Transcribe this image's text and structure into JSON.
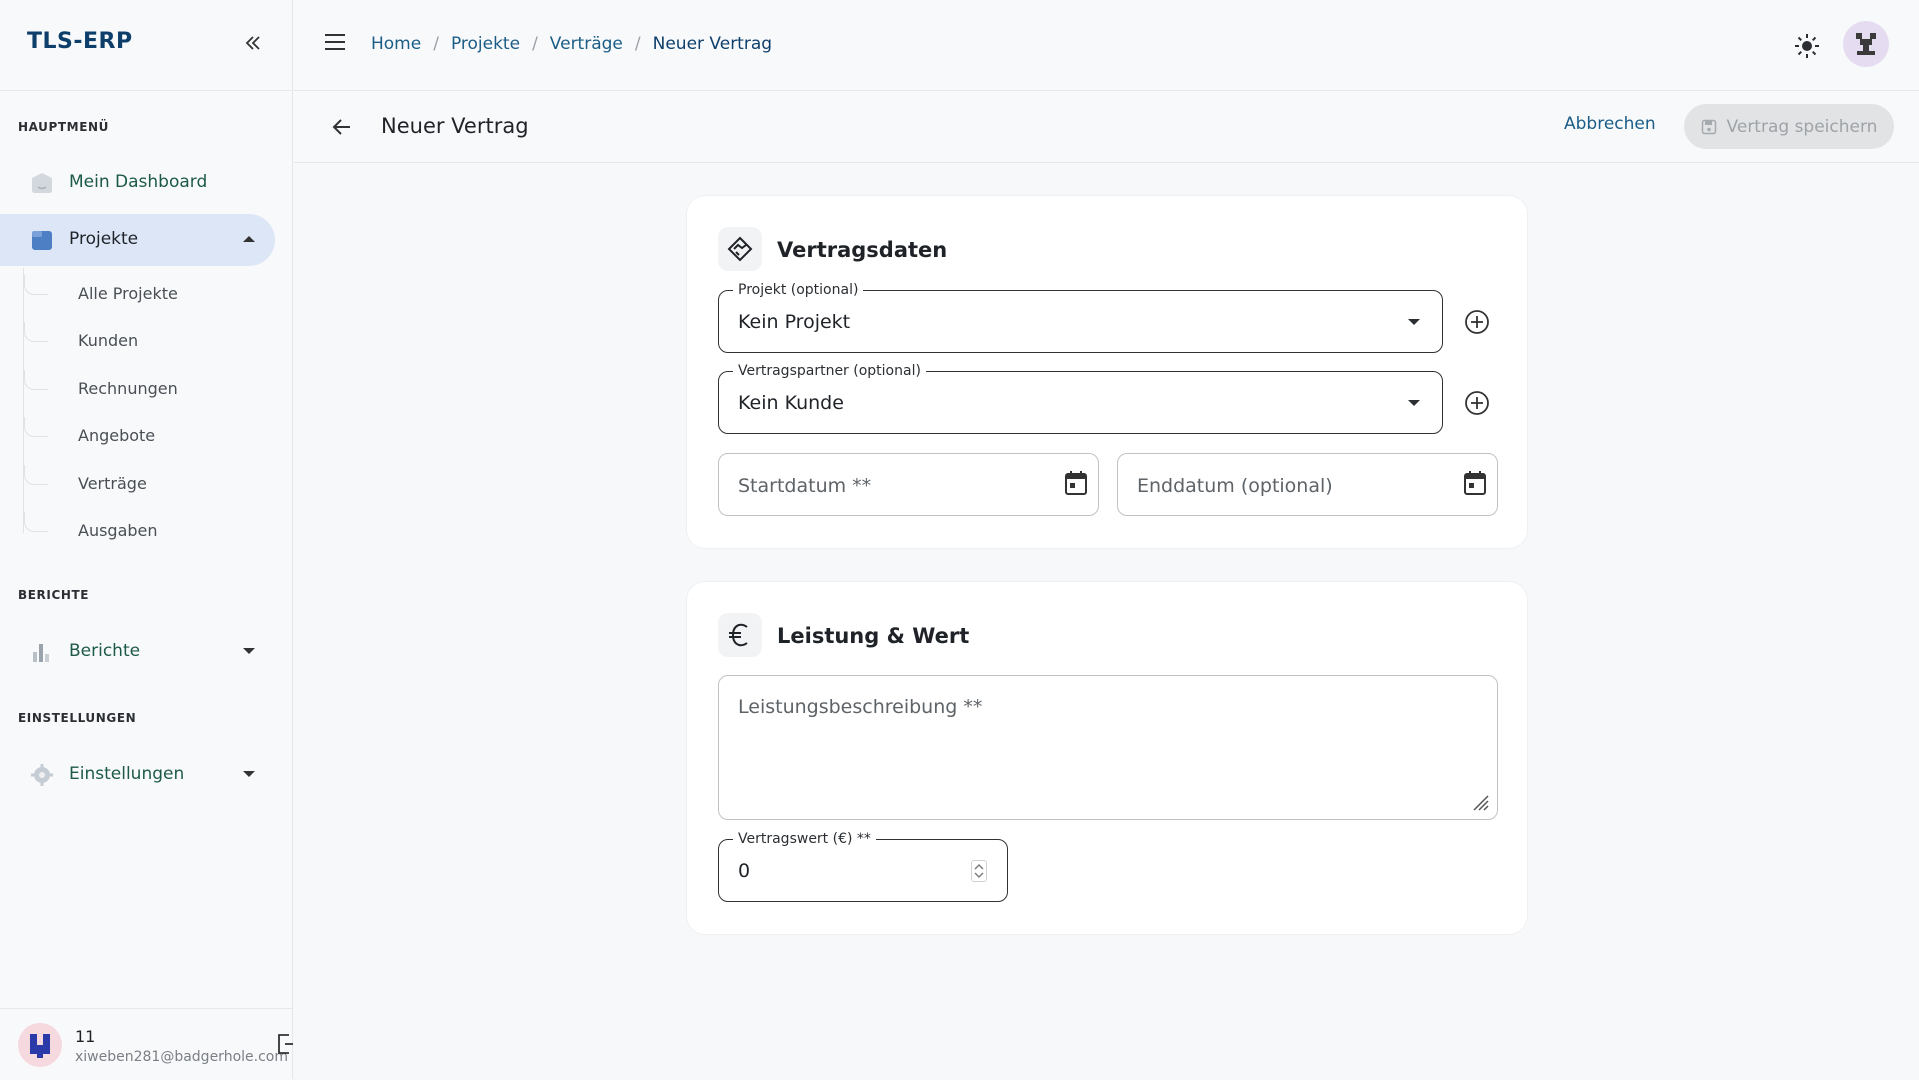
{
  "app": {
    "brand": "TLS-ERP"
  },
  "sidebar": {
    "sections": {
      "main": "HAUPTMENÜ",
      "reports": "BERICHTE",
      "settings": "EINSTELLUNGEN"
    },
    "items": [
      {
        "label": "Mein Dashboard",
        "icon": "dashboard-icon"
      },
      {
        "label": "Projekte",
        "icon": "folder-icon",
        "active": true,
        "expanded": true
      },
      {
        "label": "Berichte",
        "icon": "bar-chart-icon"
      },
      {
        "label": "Einstellungen",
        "icon": "gear-icon"
      }
    ],
    "subitems": [
      "Alle Projekte",
      "Kunden",
      "Rechnungen",
      "Angebote",
      "Verträge",
      "Ausgaben"
    ],
    "user": {
      "name": "11",
      "email": "xiweben281@badgerhole.com"
    }
  },
  "topbar": {
    "breadcrumbs": [
      "Home",
      "Projekte",
      "Verträge",
      "Neuer Vertrag"
    ]
  },
  "page": {
    "title": "Neuer Vertrag",
    "cancel_label": "Abbrechen",
    "save_label": "Vertrag speichern"
  },
  "card1": {
    "title": "Vertragsdaten",
    "project": {
      "label": "Projekt (optional)",
      "value": "Kein Projekt"
    },
    "partner": {
      "label": "Vertragspartner (optional)",
      "value": "Kein Kunde"
    },
    "start_placeholder": "Startdatum **",
    "end_placeholder": "Enddatum (optional)"
  },
  "card2": {
    "title": "Leistung & Wert",
    "description_placeholder": "Leistungsbeschreibung **",
    "value": {
      "label": "Vertragswert (€) **",
      "value": "0"
    }
  },
  "colors": {
    "brand": "#0e3f6b",
    "link": "#1b5d86",
    "active_nav_bg": "#dce6f7",
    "nav_text": "#1c5a45"
  }
}
